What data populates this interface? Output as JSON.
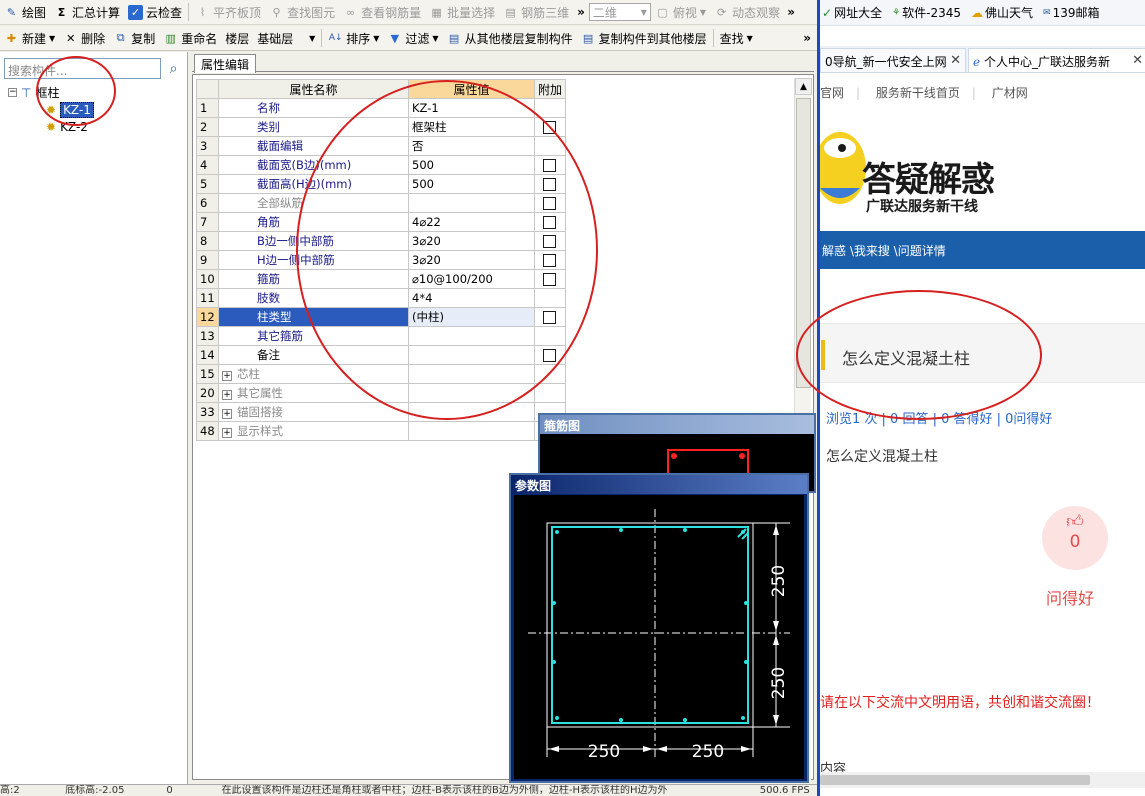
{
  "toolbar1": {
    "items": [
      "绘图",
      "汇总计算",
      "云检查",
      "平齐板顶",
      "查找图元",
      "查看钢筋量",
      "批量选择",
      "钢筋三维"
    ],
    "view_combo": "二维",
    "view_combo2": "俯视",
    "dynamic": "动态观察"
  },
  "toolbar2": {
    "new": "新建",
    "delete": "删除",
    "copy": "复制",
    "rename": "重命名",
    "floor_label": "楼层",
    "floor_value": "基础层",
    "sort": "排序",
    "filter": "过滤",
    "copy_from_floor": "从其他楼层复制构件",
    "copy_to_floor": "复制构件到其他楼层",
    "find": "查找"
  },
  "left": {
    "search_placeholder": "搜索构件...",
    "tree_root": "框柱",
    "tree_items": [
      "KZ-1",
      "KZ-2"
    ]
  },
  "prop_tab": "属性编辑",
  "grid": {
    "headers": [
      "属性名称",
      "属性值",
      "附加"
    ],
    "rows": [
      {
        "num": "1",
        "name": "名称",
        "value": "KZ-1"
      },
      {
        "num": "2",
        "name": "类别",
        "value": "框架柱"
      },
      {
        "num": "3",
        "name": "截面编辑",
        "value": "否"
      },
      {
        "num": "4",
        "name": "截面宽(B边)(mm)",
        "value": "500"
      },
      {
        "num": "5",
        "name": "截面高(H边)(mm)",
        "value": "500"
      },
      {
        "num": "6",
        "name": "全部纵筋",
        "value": ""
      },
      {
        "num": "7",
        "name": "角筋",
        "value": "4⌀22"
      },
      {
        "num": "8",
        "name": "B边一侧中部筋",
        "value": "3⌀20"
      },
      {
        "num": "9",
        "name": "H边一侧中部筋",
        "value": "3⌀20"
      },
      {
        "num": "10",
        "name": "箍筋",
        "value": "⌀10@100/200"
      },
      {
        "num": "11",
        "name": "肢数",
        "value": "4*4"
      },
      {
        "num": "12",
        "name": "柱类型",
        "value": "(中柱)"
      },
      {
        "num": "13",
        "name": "其它箍筋",
        "value": ""
      },
      {
        "num": "14",
        "name": "备注",
        "value": ""
      },
      {
        "num": "15",
        "name": "芯柱",
        "value": ""
      },
      {
        "num": "20",
        "name": "其它属性",
        "value": ""
      },
      {
        "num": "33",
        "name": "锚固搭接",
        "value": ""
      },
      {
        "num": "48",
        "name": "显示样式",
        "value": ""
      }
    ]
  },
  "winA_title": "箍筋图",
  "winB_title": "参数图",
  "dims": {
    "v1": "250",
    "v2": "250",
    "h1": "250",
    "h2": "250"
  },
  "statusbar": {
    "text1": "高:2",
    "text2": "底标高:-2.05",
    "text3": "0",
    "text4": "在此设置该构件是边柱还是角柱或者中柱；边柱-B表示该柱的B边为外侧，边柱-H表示该柱的H边为外",
    "text5": "500.6 FPS"
  },
  "browser": {
    "bookmarks": [
      "网址大全",
      "软件-2345",
      "佛山天气",
      "139邮箱"
    ],
    "tab1": "0导航_新一代安全上网",
    "tab2": "个人中心_广联达服务新",
    "subnav": [
      "官网",
      "服务新干线首页",
      "广材网"
    ],
    "banner_title": "答疑解惑",
    "banner_sub": "广联达服务新干线",
    "breadcrumb": "解惑 \\我来搜 \\问题详情",
    "question": "怎么定义混凝土柱",
    "stats": "浏览1 次 | 0 回答 | 0 答得好 | 0问得好",
    "question2": "怎么定义混凝土柱",
    "like_count": "0",
    "like_label": "问得好",
    "notice": "请在以下交流中文明用语，共创和谐交流圈！",
    "bottom": "内容"
  },
  "colors": {
    "accent_red": "#d62020",
    "cad_cyan": "#2ee0e0",
    "title_blue": "#0a246a"
  }
}
